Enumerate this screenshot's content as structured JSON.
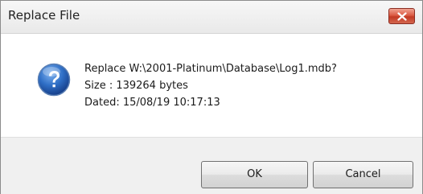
{
  "dialog": {
    "title": "Replace File",
    "icon": "question-icon",
    "message": {
      "line1": "Replace W:\\2001-Platinum\\Database\\Log1.mdb?",
      "line2": "Size : 139264 bytes",
      "line3": "Dated: 15/08/19 10:17:13"
    },
    "buttons": {
      "ok": "OK",
      "cancel": "Cancel"
    }
  },
  "colors": {
    "close_button": "#c33a24",
    "question_icon": "#1f5fb8"
  }
}
